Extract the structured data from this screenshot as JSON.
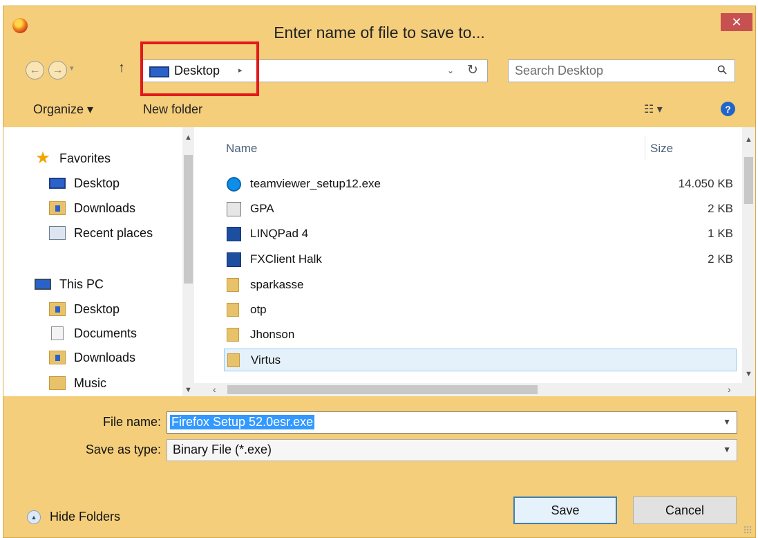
{
  "dialog": {
    "title": "Enter name of file to save to...",
    "close_glyph": "✕",
    "icons": {
      "app": "firefox-icon",
      "close": "close-icon"
    }
  },
  "address": {
    "back_glyph": "←",
    "forward_glyph": "→",
    "history_glyph": "▾",
    "up_glyph": "↑",
    "breadcrumb": "Desktop",
    "breadcrumb_arrow": "▸",
    "dropdown_glyph": "⌄",
    "refresh_glyph": "↻",
    "search_placeholder": "Search Desktop",
    "search_glyph": "⚲",
    "highlight_color": "#e11b1b"
  },
  "toolbar": {
    "organize": "Organize ▾",
    "new_folder": "New folder",
    "views_glyph": "☷ ▾",
    "help_glyph": "?"
  },
  "nav_pane": {
    "favorites_header": "Favorites",
    "favorites": [
      {
        "label": "Desktop",
        "icon": "desktop-icon"
      },
      {
        "label": "Downloads",
        "icon": "downloads-icon"
      },
      {
        "label": "Recent places",
        "icon": "recent-places-icon"
      }
    ],
    "this_pc_header": "This PC",
    "this_pc": [
      {
        "label": "Desktop",
        "icon": "desktop-folder-icon"
      },
      {
        "label": "Documents",
        "icon": "documents-icon"
      },
      {
        "label": "Downloads",
        "icon": "downloads-icon"
      },
      {
        "label": "Music",
        "icon": "music-icon"
      }
    ]
  },
  "file_list": {
    "columns": {
      "name": "Name",
      "size": "Size"
    },
    "rows": [
      {
        "name": "teamviewer_setup12.exe",
        "size": "14.050 KB",
        "icon": "teamviewer-icon",
        "selected": false
      },
      {
        "name": "GPA",
        "size": "2 KB",
        "icon": "shortcut-icon",
        "selected": false
      },
      {
        "name": "LINQPad 4",
        "size": "1 KB",
        "icon": "linqpad-icon",
        "selected": false
      },
      {
        "name": "FXClient Halk",
        "size": "2 KB",
        "icon": "fxclient-icon",
        "selected": false
      },
      {
        "name": "sparkasse",
        "size": "",
        "icon": "folder-icon",
        "selected": false
      },
      {
        "name": "otp",
        "size": "",
        "icon": "folder-icon",
        "selected": false
      },
      {
        "name": "Jhonson",
        "size": "",
        "icon": "folder-icon",
        "selected": false
      },
      {
        "name": "Virtus",
        "size": "",
        "icon": "folder-icon",
        "selected": true
      }
    ]
  },
  "form": {
    "file_name_label": "File name:",
    "file_name_value": "Firefox Setup 52.0esr.exe",
    "save_type_label": "Save as type:",
    "save_type_value": "Binary File (*.exe)"
  },
  "footer": {
    "hide_folders": "Hide Folders",
    "save": "Save",
    "cancel": "Cancel"
  },
  "colors": {
    "title_bar": "#f4ce7b",
    "close_button": "#c75050",
    "selection": "#3399ff",
    "selected_row": "#e4f1fb"
  }
}
